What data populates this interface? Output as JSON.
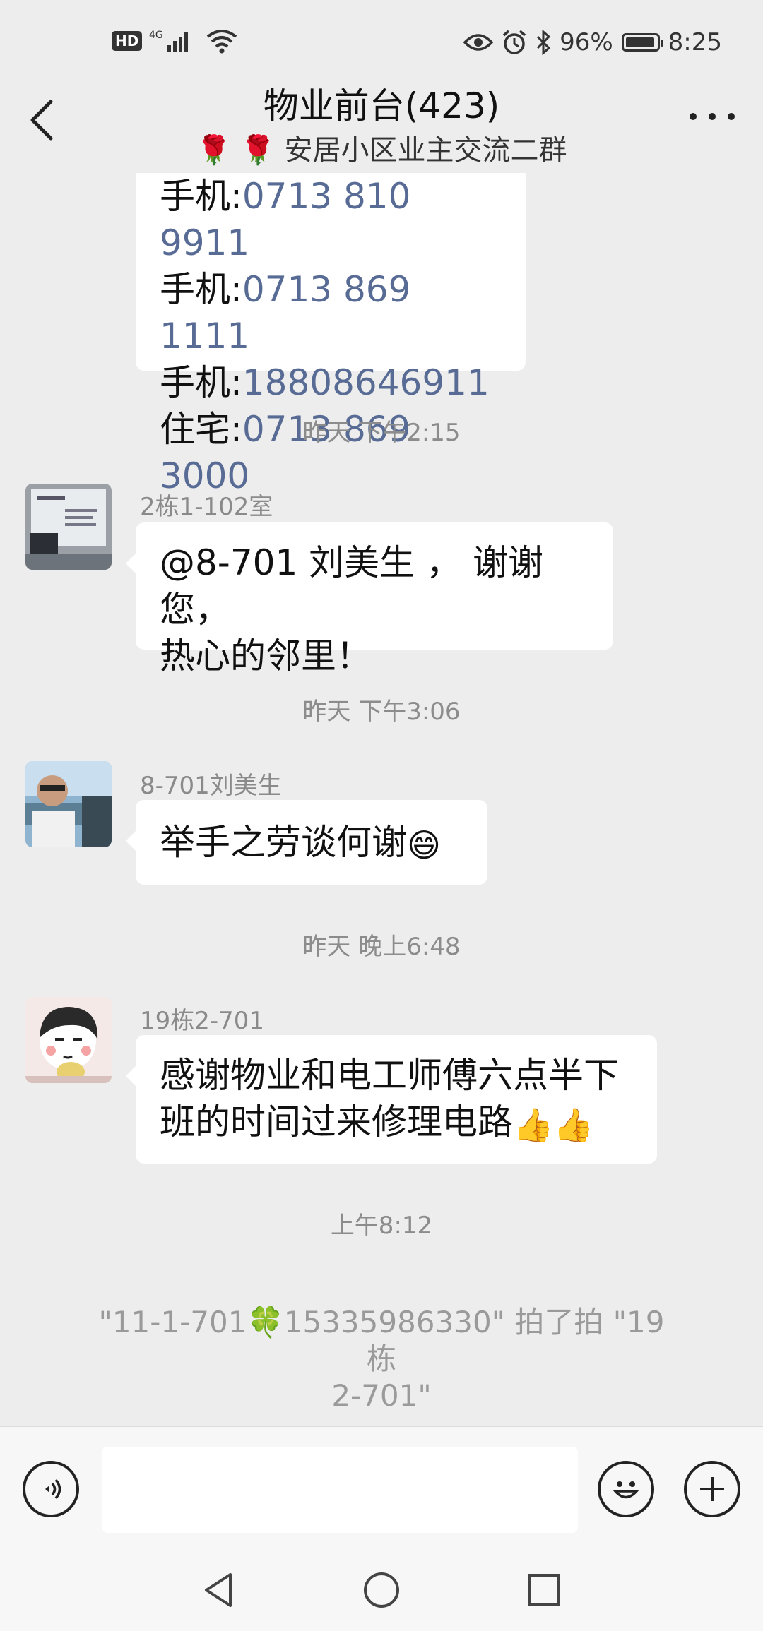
{
  "status_bar": {
    "hd": "HD",
    "network": "4G",
    "battery_percent": "96%",
    "battery_level": 0.96,
    "time": "8:25"
  },
  "header": {
    "title": "物业前台(423)",
    "subtitle": "🌹 🌹 安居小区业主交流二群"
  },
  "messages": {
    "m0": {
      "lines": [
        {
          "label": "手机:",
          "number": "0713 810 9911"
        },
        {
          "label": "手机:",
          "number": "0713 869 1111"
        },
        {
          "label": "手机:",
          "number": "18808646911"
        },
        {
          "label": "住宅:",
          "number": "0713 869 3000"
        }
      ]
    },
    "t1": "昨天 下午2:15",
    "m1": {
      "sender": "2栋1-102室",
      "line1": "@8-701 刘美生 ， 谢谢您，",
      "line2": "热心的邻里！"
    },
    "t2": "昨天 下午3:06",
    "m2": {
      "sender": "8-701刘美生",
      "text": "举手之劳谈何谢",
      "emoji": "😄"
    },
    "t3": "昨天 晚上6:48",
    "m3": {
      "sender": "19栋2-701",
      "line1": "感谢物业和电工师傅六点半下",
      "line2": "班的时间过来修理电路",
      "emoji": "👍👍"
    },
    "t4": "上午8:12",
    "system1": "\"11-1-701🍀15335986330\" 拍了拍 \"19 栋",
    "system2": "2-701\""
  },
  "input": {
    "placeholder": ""
  },
  "colors": {
    "background": "#ededed",
    "bubble": "#ffffff",
    "link": "#576b95"
  },
  "icons": [
    "back-icon",
    "more-icon",
    "voice-icon",
    "emoji-icon",
    "plus-icon",
    "nav-back-icon",
    "nav-home-icon",
    "nav-recent-icon"
  ]
}
